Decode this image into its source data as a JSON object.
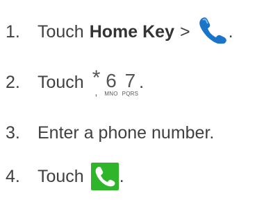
{
  "steps": [
    {
      "number": "1.",
      "text": "Touch",
      "bold": "Home Key",
      "after": ">",
      "end": ".",
      "icon": "phone-handset-icon"
    },
    {
      "number": "2.",
      "text": "Touch",
      "end": ".",
      "keys": [
        {
          "main": "*",
          "sub": ","
        },
        {
          "main": "6",
          "sub": "MNO"
        },
        {
          "main": "7",
          "sub": "PQRS"
        }
      ]
    },
    {
      "number": "3.",
      "text": "Enter a phone number."
    },
    {
      "number": "4.",
      "text": "Touch",
      "end": ".",
      "icon": "call-button-icon"
    }
  ],
  "colors": {
    "text": "#404040",
    "phone_blue": "#1a74c7",
    "call_green": "#2eb52a"
  }
}
